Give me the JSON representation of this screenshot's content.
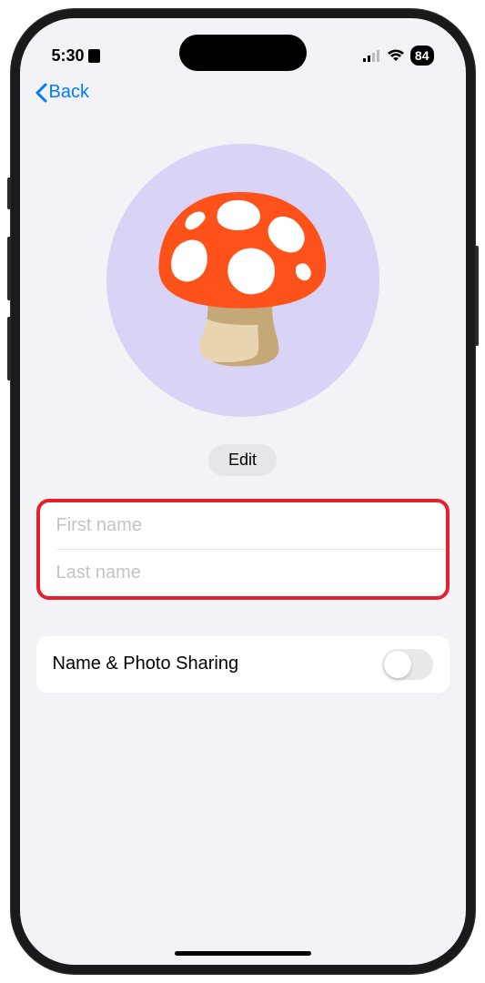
{
  "status_bar": {
    "time": "5:30",
    "battery_percent": "84"
  },
  "nav": {
    "back_label": "Back"
  },
  "profile": {
    "avatar_emoji": "🍄",
    "edit_label": "Edit",
    "first_name_placeholder": "First name",
    "first_name_value": "",
    "last_name_placeholder": "Last name",
    "last_name_value": ""
  },
  "settings": {
    "sharing_label": "Name & Photo Sharing",
    "sharing_enabled": false
  }
}
